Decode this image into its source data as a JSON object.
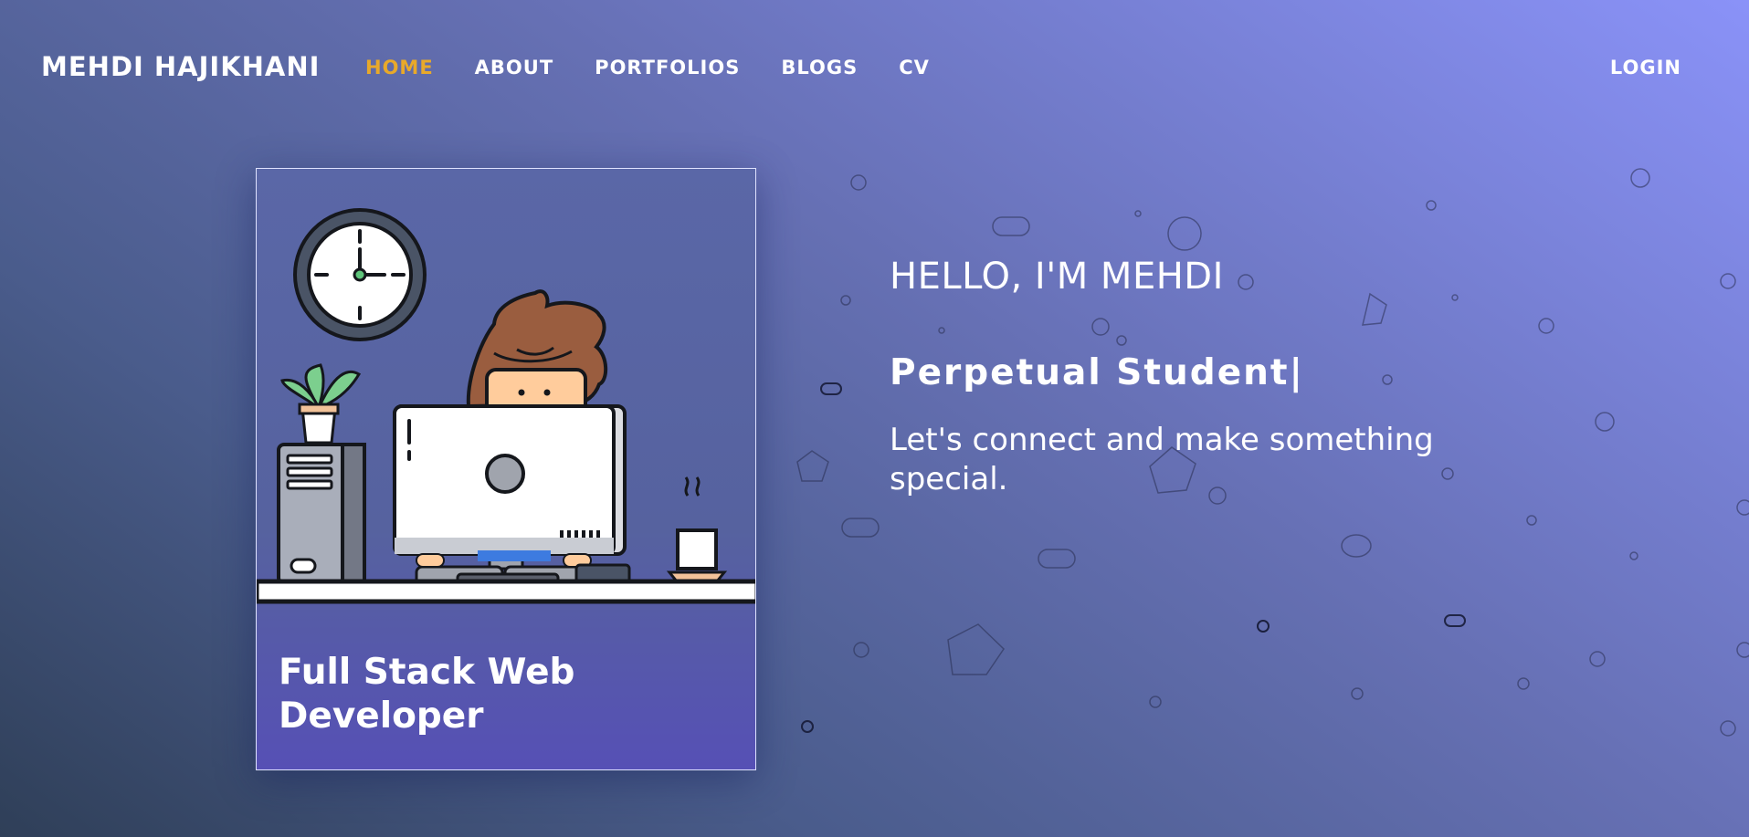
{
  "navbar": {
    "brand": "MEHDI HAJIKHANI",
    "links": [
      {
        "label": "HOME",
        "active": true
      },
      {
        "label": "ABOUT",
        "active": false
      },
      {
        "label": "PORTFOLIOS",
        "active": false
      },
      {
        "label": "BLOGS",
        "active": false
      },
      {
        "label": "CV",
        "active": false
      }
    ],
    "login_label": "LOGIN"
  },
  "card": {
    "illustration": "developer-at-desk-illustration",
    "title": "Full Stack Web Developer"
  },
  "hero": {
    "greeting": "HELLO, I'M MEHDI",
    "role": "Perpetual Student|",
    "cta": "Let's connect and make something special."
  },
  "colors": {
    "accent_active_nav": "#e8a92a",
    "text": "#ffffff",
    "bg_dark": "#2f3f58",
    "bg_light": "#8a92f8"
  }
}
